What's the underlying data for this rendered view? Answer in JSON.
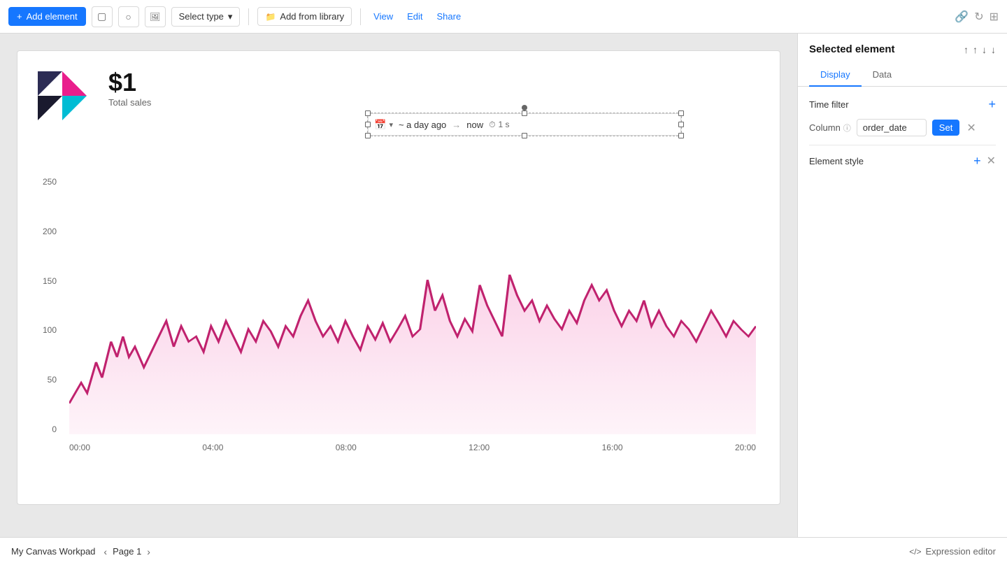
{
  "toolbar": {
    "add_element_label": "Add element",
    "select_type_label": "Select type",
    "add_from_library_label": "Add from library",
    "view_label": "View",
    "edit_label": "Edit",
    "share_label": "Share"
  },
  "canvas": {
    "logo_alt": "Logo",
    "metric": {
      "value": "$1",
      "label": "Total sales"
    },
    "time_filter": {
      "from": "~ a day ago",
      "arrow": "→",
      "to": "now",
      "refresh": "1 s"
    },
    "chart": {
      "y_labels": [
        "250",
        "200",
        "150",
        "100",
        "50",
        "0"
      ],
      "x_labels": [
        "00:00",
        "04:00",
        "08:00",
        "12:00",
        "16:00",
        "20:00"
      ]
    }
  },
  "right_panel": {
    "title": "Selected element",
    "tabs": [
      {
        "label": "Display",
        "active": true
      },
      {
        "label": "Data",
        "active": false
      }
    ],
    "time_filter_section": {
      "title": "Time filter",
      "column_label": "Column",
      "column_value": "order_date",
      "set_label": "Set"
    },
    "element_style_section": {
      "title": "Element style"
    }
  },
  "bottom_bar": {
    "workpad_name": "My Canvas Workpad",
    "page_label": "Page 1",
    "expression_editor_label": "Expression editor"
  },
  "icons": {
    "plus": "+",
    "square": "▢",
    "circle": "○",
    "image": "🖼",
    "chevron_down": "▾",
    "folder": "📁",
    "up_arrow": "↑",
    "up_arrow2": "↑",
    "down_arrow": "↓",
    "down_arrow2": "↓",
    "link": "🔗",
    "refresh": "↻",
    "grid": "⊞",
    "calendar": "📅",
    "clock": "⏱",
    "info": "ⓘ",
    "code": "</>",
    "chevron_left": "‹",
    "chevron_right": "›"
  }
}
